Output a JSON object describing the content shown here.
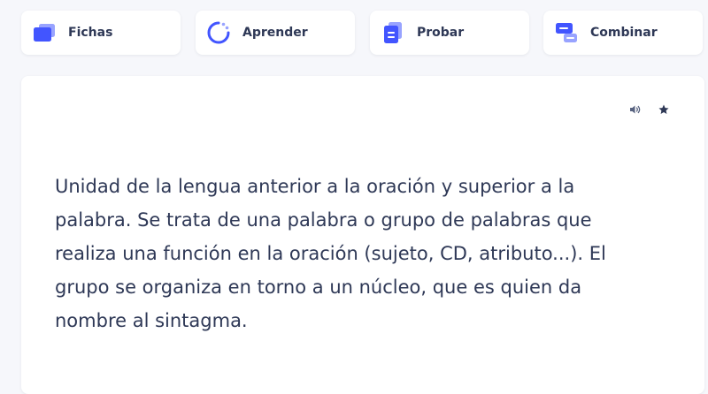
{
  "modes": [
    {
      "label": "Fichas",
      "icon": "flashcards-icon"
    },
    {
      "label": "Aprender",
      "icon": "learn-icon"
    },
    {
      "label": "Probar",
      "icon": "test-icon"
    },
    {
      "label": "Combinar",
      "icon": "match-icon"
    }
  ],
  "card": {
    "definition": "Unidad de la lengua anterior a la oración y superior a la palabra. Se trata de una palabra o grupo de palabras que realiza una función en la oración (sujeto, CD, atributo...). El grupo se organiza en torno a un núcleo, que es quien da nombre al sintagma.",
    "audio_icon": "speaker-icon",
    "star_icon": "star-icon"
  },
  "colors": {
    "background": "#f6f7fb",
    "card": "#ffffff",
    "text": "#2e3856",
    "accent": "#4255ff",
    "accent_light": "#98a3ff"
  }
}
